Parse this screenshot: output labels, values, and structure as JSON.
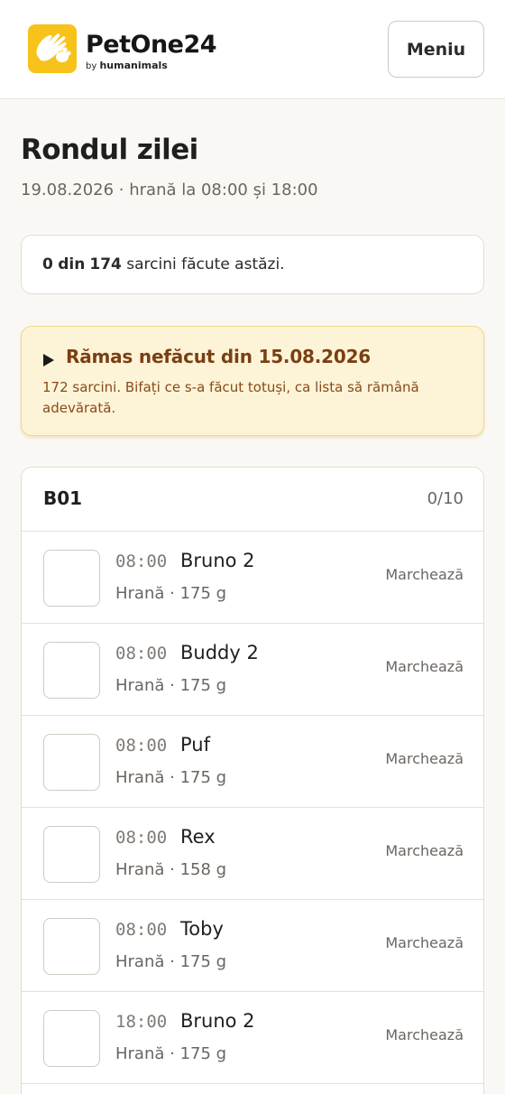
{
  "header": {
    "brand_name": "PetOne24",
    "brand_sub_prefix": "by",
    "brand_sub_name": "humanimals",
    "logo_icon": "hands-paw-logo-icon",
    "menu_label": "Meniu"
  },
  "page": {
    "title": "Rondul zilei",
    "subtitle": "19.08.2026 · hrană la 08:00 și 18:00"
  },
  "progress": {
    "done": "0",
    "of_word": "din",
    "total": "174",
    "suffix": "sarcini făcute astăzi."
  },
  "warning": {
    "title": "Rămas nefăcut din 15.08.2026",
    "text": "172 sarcini. Bifați ce s-a făcut totuși, ca lista să rămână adevărată."
  },
  "group": {
    "name": "B01",
    "count": "0/10",
    "tasks": [
      {
        "time": "08:00",
        "name": "Bruno 2",
        "detail": "Hrană · 175 g",
        "action": "Marchează"
      },
      {
        "time": "08:00",
        "name": "Buddy 2",
        "detail": "Hrană · 175 g",
        "action": "Marchează"
      },
      {
        "time": "08:00",
        "name": "Puf",
        "detail": "Hrană · 175 g",
        "action": "Marchează"
      },
      {
        "time": "08:00",
        "name": "Rex",
        "detail": "Hrană · 158 g",
        "action": "Marchează"
      },
      {
        "time": "08:00",
        "name": "Toby",
        "detail": "Hrană · 175 g",
        "action": "Marchează"
      },
      {
        "time": "18:00",
        "name": "Bruno 2",
        "detail": "Hrană · 175 g",
        "action": "Marchează"
      }
    ]
  },
  "colors": {
    "brand_yellow": "#f7c21a",
    "warning_bg": "#fdf4d8",
    "warning_text": "#7a3f12"
  }
}
